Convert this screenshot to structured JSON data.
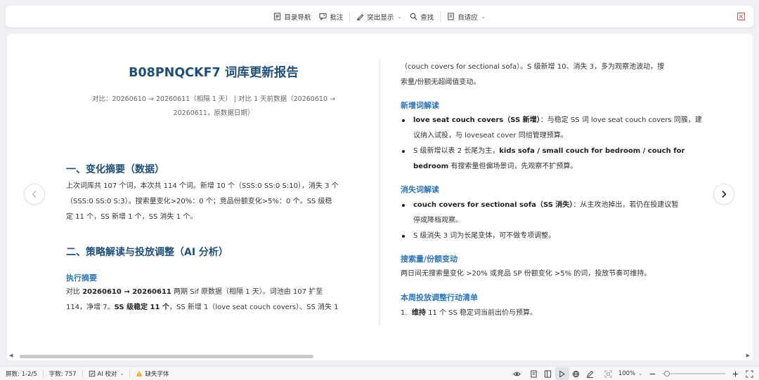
{
  "toolbar": {
    "toc_nav": "目录导航",
    "annotate": "批注",
    "highlight": "突出显示",
    "find": "查找",
    "fit": "自适应"
  },
  "doc": {
    "title": "B08PNQCKF7 词库更新报告",
    "subtitle_line1": "对比：20260610 → 20260611（相隔 1 天） | 对比 1 天前数据（20260610 →",
    "subtitle_line2": "20260611，原数据日期）",
    "sec1_title": "一、变化摘要（数据）",
    "sec1_p1": "上次词库共 107 个词，本次共 114 个词。新增 10 个（SSS:0 SS:0 S:10），消失 3 个",
    "sec1_p2": "（SSS:0 SS:0 S:3）。搜索量变化>20%：0 个；竞品份额变化>5%：0 个。SS 级稳",
    "sec1_p3": "定 11 个，SS 新增 1 个，SS 消失 1 个。",
    "sec2_title": "二、策略解读与投放调整（AI 分析）",
    "exec_title": "执行摘要",
    "exec_l1_a": "对比 ",
    "exec_l1_b": "20260610 → 20260611",
    "exec_l1_c": " 两期 Sif 原数据（相隔 1 天）。词池由 107 扩至",
    "exec_l2_a": "114，净增 7。",
    "exec_l2_b": "SS 级稳定 11 个",
    "exec_l2_c": "，SS 新增 1（love seat couch covers）、SS 消失 1",
    "r_cont_l1": "（couch covers for sectional sofa）。S 级新增 10、消失 3，多为观察池波动，搜",
    "r_cont_l2": "索量/份额无超阈值变动。",
    "new_title": "新增词解读",
    "new_b1_bold": "love seat couch covers（SS 新增）",
    "new_b1_l1": "：与稳定 SS 词 love seat couch covers 同簇，建",
    "new_b1_l2": "议纳入试投，与 loveseat cover 同组管理预算。",
    "new_b2_l1a": "S 级新增以表 2 长尾为主，",
    "new_b2_l1b": "kids sofa / small couch for bedroom / couch for",
    "new_b2_l2a": "bedroom",
    "new_b2_l2b": " 有搜索量但偏场景词，先观察不扩预算。",
    "lost_title": "消失词解读",
    "lost_b1_bold": "couch covers for sectional sofa（SS 消失）",
    "lost_b1_l1": "：从主攻池掉出，若仍在投建议暂",
    "lost_b1_l2": "停或降档观察。",
    "lost_b2": "S 级消失 3 词为长尾变体，可不做专项调整。",
    "vol_title": "搜索量/份额变动",
    "vol_p": "两日间无搜索量变化 >20% 或竞品 SP 份额变化 >5% 的词，投放节奏可维持。",
    "action_title": "本周投放调整行动清单",
    "action_1_num": "1.",
    "action_1_bold": "维持",
    "action_1_rest": " 11 个 SS 稳定词当前出价与预算。"
  },
  "status": {
    "screens": "屏数: 1-2/5",
    "words": "字数: 757",
    "ai_check": "AI 校对",
    "missing_font": "缺失字体",
    "zoom": "100%"
  },
  "colors": {
    "heading": "#1f4e79",
    "subheading": "#2e75b6",
    "close": "#d9534f"
  }
}
